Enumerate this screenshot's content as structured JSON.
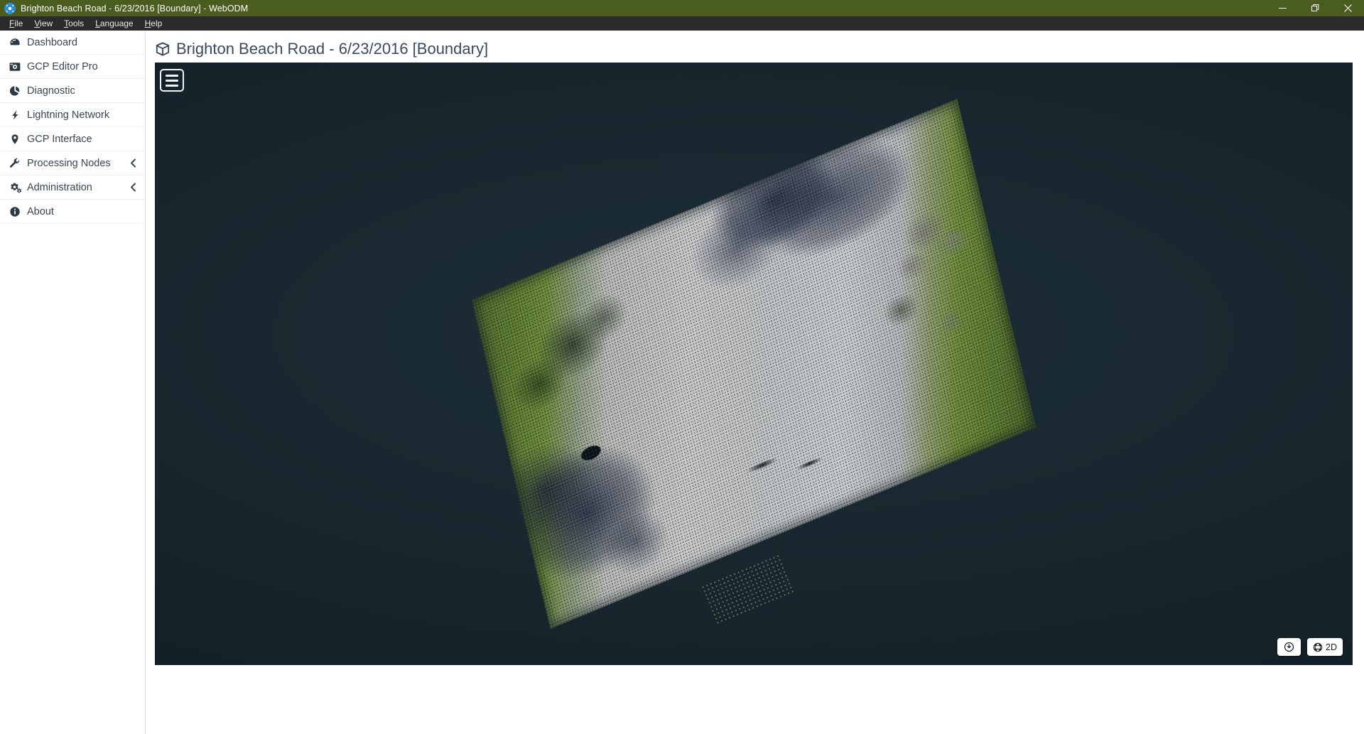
{
  "window": {
    "title": "Brighton Beach Road - 6/23/2016 [Boundary] - WebODM",
    "app_icon": "webodm-logo-icon",
    "titlebar_color": "#4b5d1e",
    "controls": {
      "minimize": "minimize-icon",
      "restore": "restore-icon",
      "close": "close-icon"
    }
  },
  "menubar": {
    "items": [
      {
        "label": "File",
        "accel": "F"
      },
      {
        "label": "View",
        "accel": "V"
      },
      {
        "label": "Tools",
        "accel": "T"
      },
      {
        "label": "Language",
        "accel": "L"
      },
      {
        "label": "Help",
        "accel": "H"
      }
    ]
  },
  "sidebar": {
    "items": [
      {
        "label": "Dashboard",
        "icon": "dashboard-icon",
        "chevron": false
      },
      {
        "label": "GCP Editor Pro",
        "icon": "gcp-editor-icon",
        "chevron": false
      },
      {
        "label": "Diagnostic",
        "icon": "pie-chart-icon",
        "chevron": false
      },
      {
        "label": "Lightning Network",
        "icon": "bolt-icon",
        "chevron": false
      },
      {
        "label": "GCP Interface",
        "icon": "map-marker-icon",
        "chevron": false
      },
      {
        "label": "Processing Nodes",
        "icon": "wrench-icon",
        "chevron": true
      },
      {
        "label": "Administration",
        "icon": "cogs-icon",
        "chevron": true
      },
      {
        "label": "About",
        "icon": "info-circle-icon",
        "chevron": false
      }
    ],
    "chevron_icon": "chevron-left-icon"
  },
  "main": {
    "page_title": "Brighton Beach Road - 6/23/2016 [Boundary]",
    "page_title_icon": "cube-icon",
    "title_color": "#3a4a5c"
  },
  "viewer": {
    "menu_button": "hamburger-menu-icon",
    "background_color": "#17242c",
    "model": "point-cloud-brighton-beach-road",
    "tools": [
      {
        "name": "measure-clock-button",
        "icon": "clock-circle-icon",
        "label": ""
      },
      {
        "name": "view-mode-button",
        "icon": "globe-icon",
        "label": "2D"
      }
    ]
  }
}
